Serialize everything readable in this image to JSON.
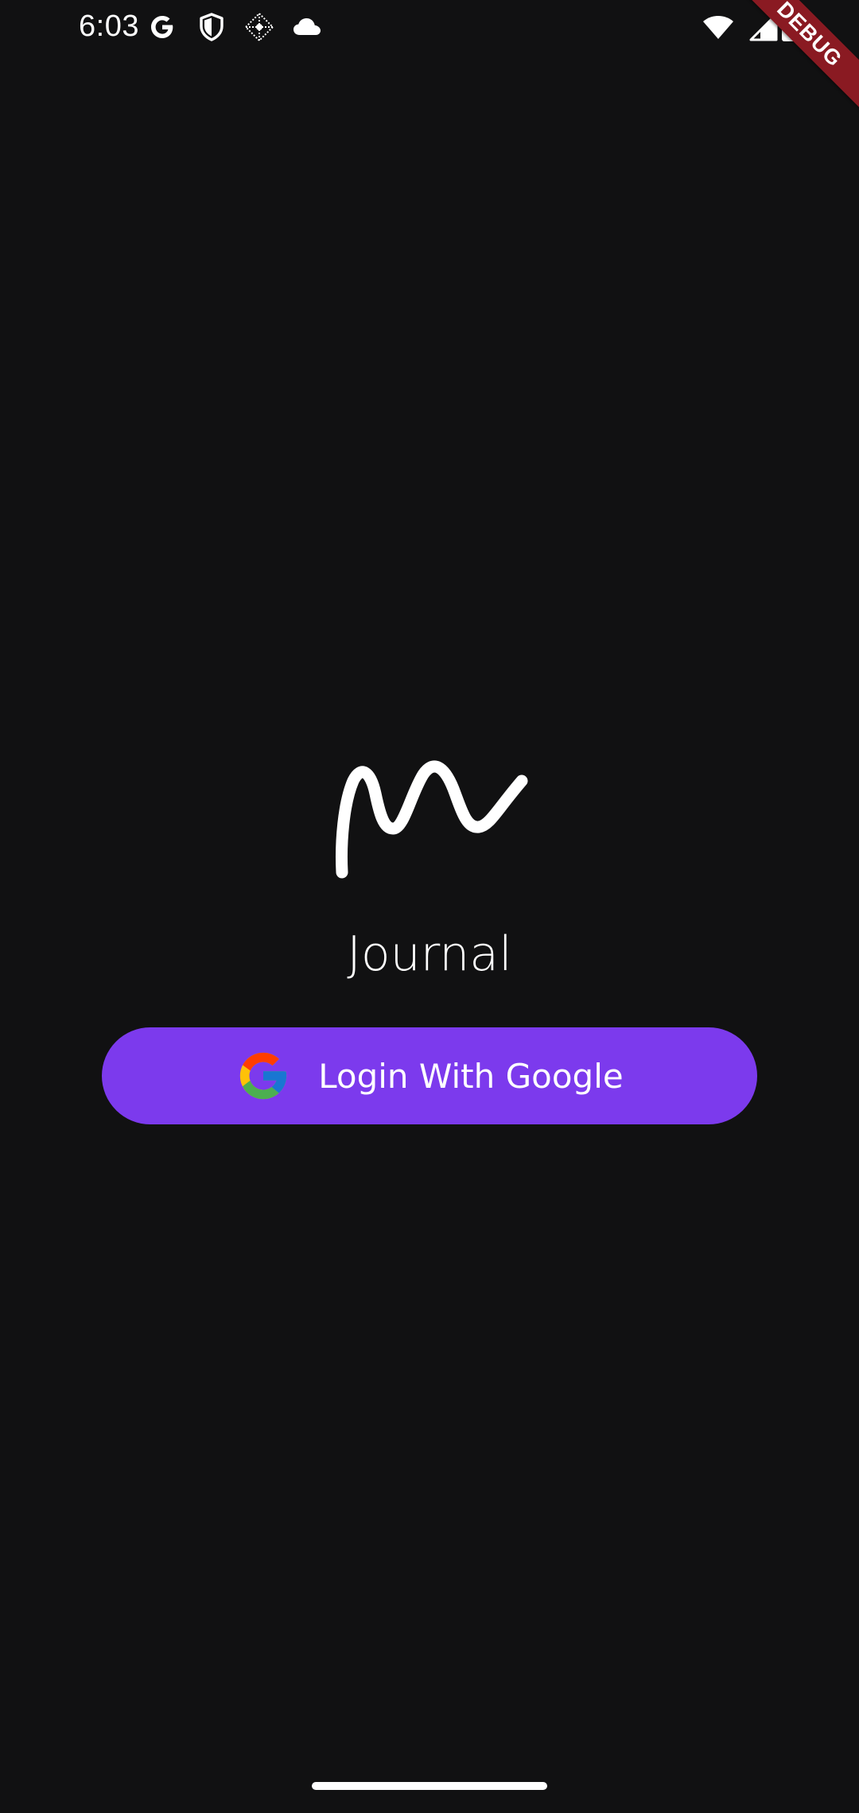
{
  "status_bar": {
    "time": "6:03",
    "left_icons": [
      "google-g-icon",
      "shield-icon",
      "screen-record-icon",
      "cloud-icon"
    ],
    "right_icons": [
      "wifi-icon",
      "cellular-signal-icon",
      "battery-icon"
    ]
  },
  "debug_banner": {
    "label": "DEBUG",
    "color": "#8a1a22"
  },
  "app": {
    "logo_icon": "signature-logo-icon",
    "title": "Journal"
  },
  "login": {
    "button_label": "Login With Google",
    "button_color": "#7c3aed",
    "icon": "google-icon"
  },
  "colors": {
    "background": "#111112",
    "text": "#ffffff"
  }
}
